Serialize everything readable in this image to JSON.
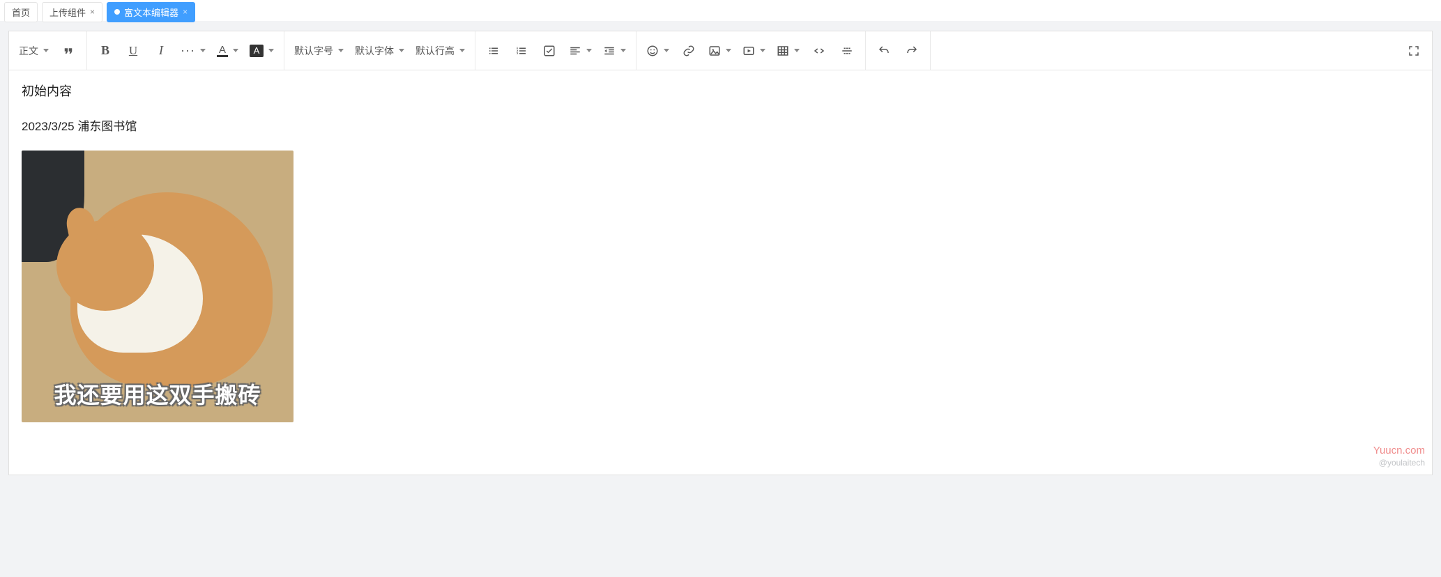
{
  "tabs": [
    {
      "label": "首页",
      "closable": false,
      "active": false
    },
    {
      "label": "上传组件",
      "closable": true,
      "active": false
    },
    {
      "label": "富文本编辑器",
      "closable": true,
      "active": true
    }
  ],
  "toolbar": {
    "heading": "正文",
    "font_size": "默认字号",
    "font_family": "默认字体",
    "line_height": "默认行高",
    "font_color_letter": "A",
    "bg_color_letter": "A",
    "bold_glyph": "B",
    "underline_glyph": "U",
    "italic_glyph": "I"
  },
  "content": {
    "line1": "初始内容",
    "line2": "2023/3/25  浦东图书馆",
    "image_caption": "我还要用这双手搬砖"
  },
  "watermark": {
    "line1": "Yuucn.com",
    "line2": "@youlaitech"
  }
}
